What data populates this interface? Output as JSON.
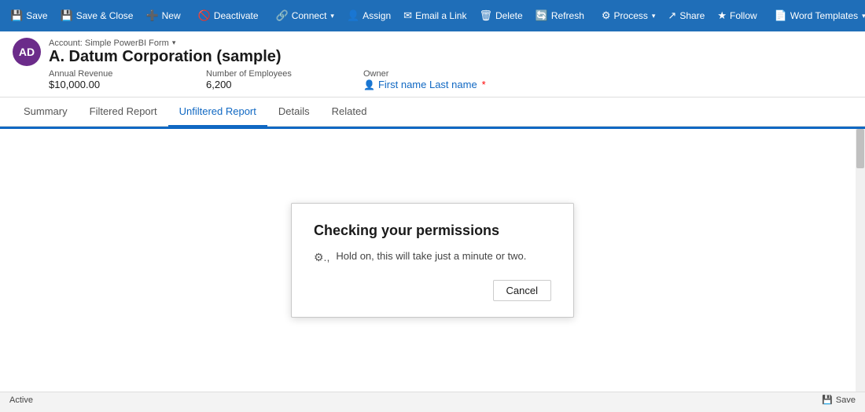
{
  "toolbar": {
    "buttons": [
      {
        "id": "save",
        "label": "Save",
        "icon": "💾"
      },
      {
        "id": "save-close",
        "label": "Save & Close",
        "icon": "💾"
      },
      {
        "id": "new",
        "label": "New",
        "icon": "➕"
      },
      {
        "id": "deactivate",
        "label": "Deactivate",
        "icon": "🚫"
      },
      {
        "id": "connect",
        "label": "Connect",
        "icon": "🔗",
        "has_caret": true
      },
      {
        "id": "assign",
        "label": "Assign",
        "icon": "👤"
      },
      {
        "id": "email-link",
        "label": "Email a Link",
        "icon": "✉"
      },
      {
        "id": "delete",
        "label": "Delete",
        "icon": "🗑"
      },
      {
        "id": "refresh",
        "label": "Refresh",
        "icon": "🔄"
      },
      {
        "id": "process",
        "label": "Process",
        "icon": "⚙",
        "has_caret": true
      },
      {
        "id": "share",
        "label": "Share",
        "icon": "↗"
      },
      {
        "id": "follow",
        "label": "Follow",
        "icon": "★"
      },
      {
        "id": "word-templates",
        "label": "Word Templates",
        "icon": "📄",
        "has_caret": true
      }
    ]
  },
  "record": {
    "avatar_initials": "AD",
    "avatar_color": "#6b2b8a",
    "form_label": "Account: Simple PowerBI Form",
    "name": "A. Datum Corporation (sample)",
    "fields": [
      {
        "label": "Annual Revenue",
        "value": "$10,000.00",
        "type": "text"
      },
      {
        "label": "Number of Employees",
        "value": "6,200",
        "type": "text"
      },
      {
        "label": "Owner",
        "value": "First name Last name",
        "type": "link",
        "required": true
      }
    ]
  },
  "tabs": [
    {
      "id": "summary",
      "label": "Summary"
    },
    {
      "id": "filtered-report",
      "label": "Filtered Report"
    },
    {
      "id": "unfiltered-report",
      "label": "Unfiltered Report",
      "active": true
    },
    {
      "id": "details",
      "label": "Details"
    },
    {
      "id": "related",
      "label": "Related"
    }
  ],
  "dialog": {
    "title": "Checking your permissions",
    "body": "Hold on, this will take just a minute or two.",
    "cancel_label": "Cancel",
    "spinner": "⚙.,"
  },
  "status_bar": {
    "status": "Active",
    "save_label": "Save"
  }
}
